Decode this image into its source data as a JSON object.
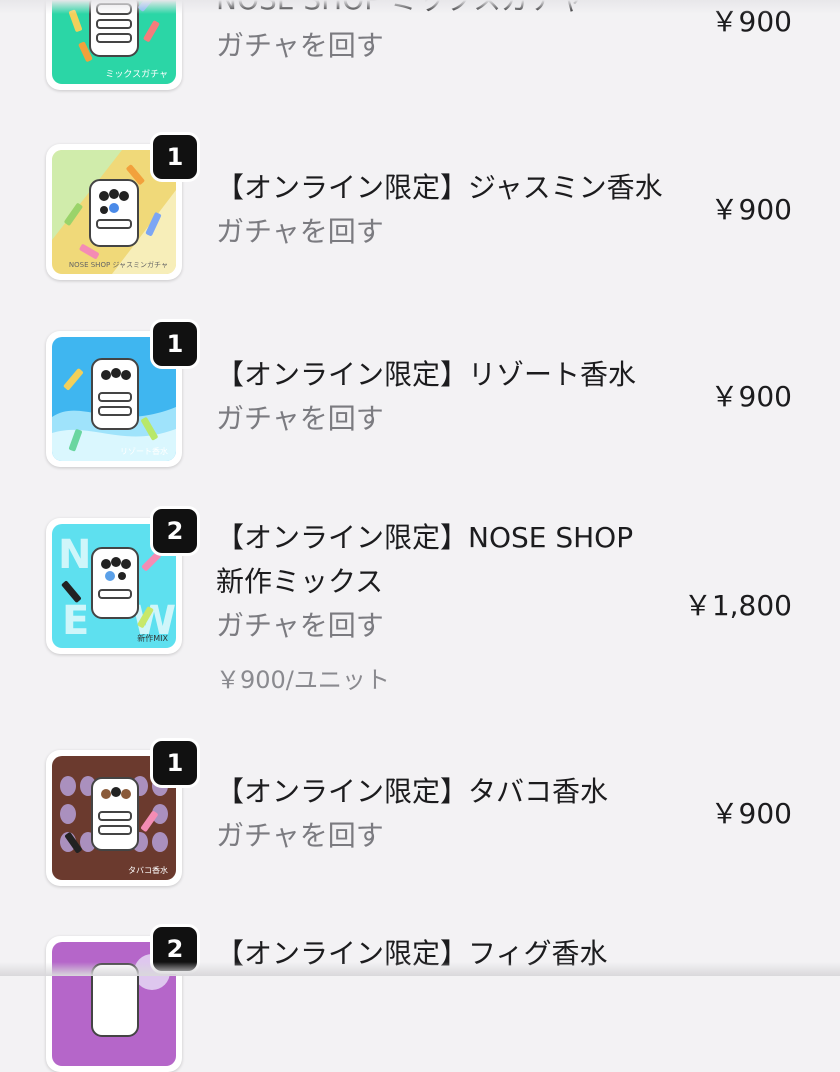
{
  "items": [
    {
      "title": "NOSE SHOP ミックスガチャ",
      "action": "ガチャを回す",
      "price": "￥900",
      "qty": "",
      "caption": "ミックスガチャ",
      "bg": "#2bd6a6"
    },
    {
      "title": "【オンライン限定】ジャスミン香水",
      "action": "ガチャを回す",
      "price": "￥900",
      "qty": "1",
      "caption": "NOSE SHOP ジャスミンガチャ",
      "bg": "#f0d979"
    },
    {
      "title": "【オンライン限定】リゾート香水",
      "action": "ガチャを回す",
      "price": "￥900",
      "qty": "1",
      "caption": "リゾート香水",
      "bg": "#3fb6f0"
    },
    {
      "title_line1": "【オンライン限定】NOSE SHOP",
      "title_line2": "新作ミックス",
      "action": "ガチャを回す",
      "unit_price": "￥900/ユニット",
      "price": "￥1,800",
      "qty": "2",
      "caption": "新作MIX",
      "bg": "#5ee0ef"
    },
    {
      "title": "【オンライン限定】タバコ香水",
      "action": "ガチャを回す",
      "price": "￥900",
      "qty": "1",
      "caption": "タバコ香水",
      "bg": "#6b3a2e"
    },
    {
      "title": "【オンライン限定】フィグ香水",
      "qty": "2",
      "bg": "#b566c9"
    }
  ],
  "icons": {
    "thumbnail": "gacha-machine-image",
    "quantity": "quantity-badge"
  }
}
